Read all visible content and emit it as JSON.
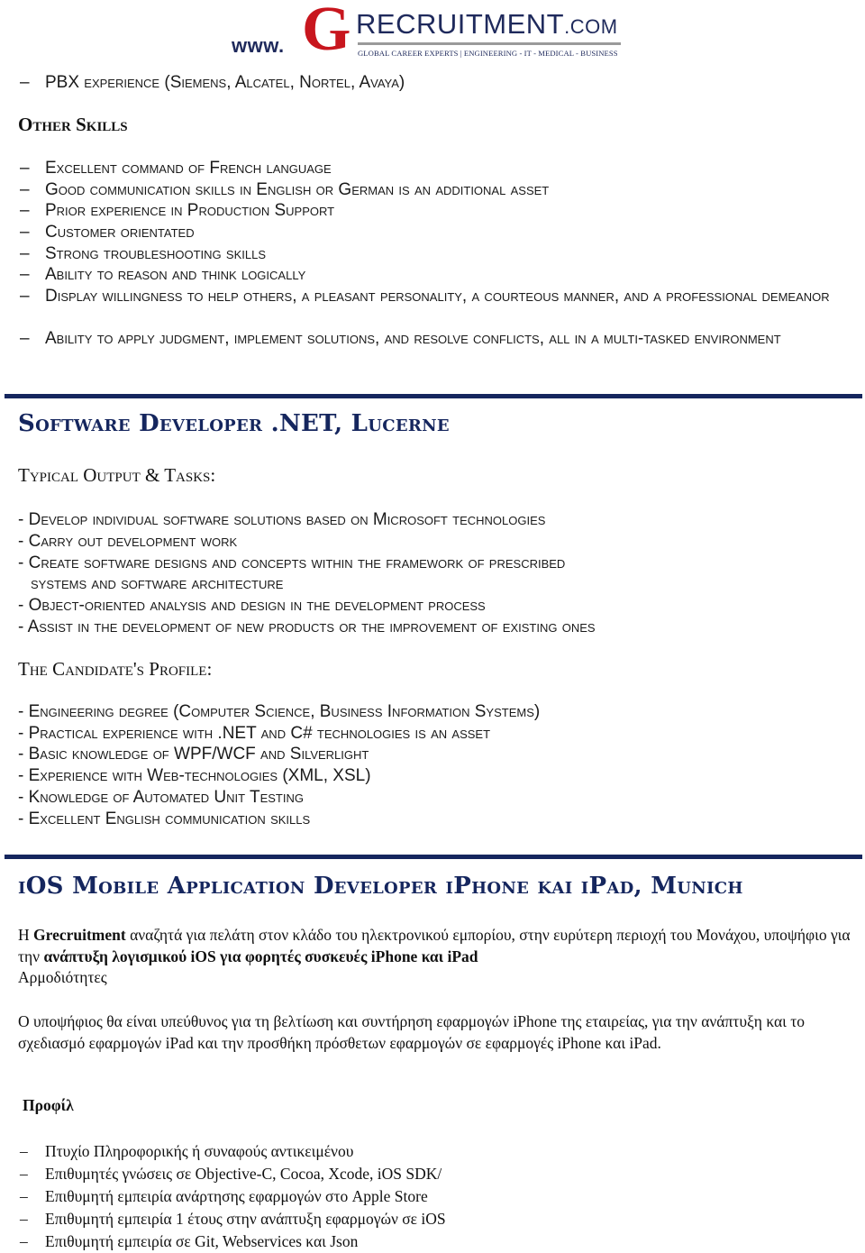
{
  "logo": {
    "prefix": "www.",
    "initial": "G",
    "name": "RECRUITMENT",
    "tld": ".COM",
    "tagline": "GLOBAL CAREER EXPERTS | ENGINEERING - IT - MEDICAL - BUSINESS",
    "colors": {
      "navy": "#1f2a5c",
      "red": "#c8161e",
      "grey": "#9a9a9a"
    }
  },
  "top_items": [
    "PBX experience (Siemens, Alcatel, Nortel, Avaya)"
  ],
  "other_skills": {
    "heading": "Other Skills",
    "items": [
      "Excellent command of French language",
      "Good communication skills in English or German is an additional asset",
      "Prior experience in Production Support",
      "Customer orientated",
      "Strong troubleshooting skills",
      "Ability to reason and think logically",
      "Display willingness to help others, a pleasant personality, a courteous manner, and a professional demeanor",
      "Ability to apply judgment, implement solutions, and resolve conflicts, all in a multi-tasked environment"
    ]
  },
  "dash": "–",
  "job1": {
    "title": "Software Developer .NET, Lucerne",
    "tasks_heading": "Typical Output & Tasks:",
    "tasks": [
      "Develop individual software solutions based on Microsoft technologies",
      "Carry out development work",
      "Create software designs and concepts within the framework of prescribed",
      "systems and software architecture",
      "Object-oriented analysis and design in the development process",
      "Assist in the development of new products or the improvement of existing ones"
    ],
    "profile_heading": "The Candidate's Profile:",
    "profile": [
      "Engineering degree (Computer Science, Business Information Systems)",
      "Practical experience with .NET and C# technologies is an asset",
      "Basic knowledge of WPF/WCF and Silverlight",
      "Experience with Web-technologies (XML, XSL)",
      "Knowledge of Automated Unit Testing",
      "Excellent English communication skills"
    ]
  },
  "job2": {
    "title": "iOS Mobile Application Developer iPhone και iPad, Munich",
    "intro": {
      "p1_a": "Η ",
      "p1_b": "Grecruitment",
      "p1_c": " αναζητά για πελάτη στον κλάδο του ηλεκτρονικού εμπορίου, στην ευρύτερη περιοχή του Μονάχου, υποψήφιο για την ",
      "p1_d": "ανάπτυξη λογισμικού iOS για φορητές συσκευές iPhone και iPad",
      "p1_e": "Αρμοδιότητες"
    },
    "description": "Ο υποψήφιος θα είναι υπεύθυνος για τη βελτίωση και συντήρηση εφαρμογών iPhone της εταιρείας, για την ανάπτυξη και το σχεδιασμό εφαρμογών iPad και την προσθήκη πρόσθετων εφαρμογών σε εφαρμογές iPhone και iPad.",
    "profile_heading": "Προφίλ",
    "profile": [
      "Πτυχίο Πληροφορικής ή συναφούς αντικειμένου",
      "Επιθυμητές γνώσεις σε Objective-C, Cocoa, Xcode, iOS SDK/",
      "Επιθυμητή εμπειρία ανάρτησης εφαρμογών στο Apple Store",
      "Επιθυμητή εμπειρία 1 έτους στην ανάπτυξη εφαρμογών σε iOS",
      "Επιθυμητή εμπειρία σε Git, Webservices και Json"
    ]
  },
  "colors": {
    "rule": "#15265e",
    "job_title": "#15265e",
    "text": "#1a1a1a"
  }
}
